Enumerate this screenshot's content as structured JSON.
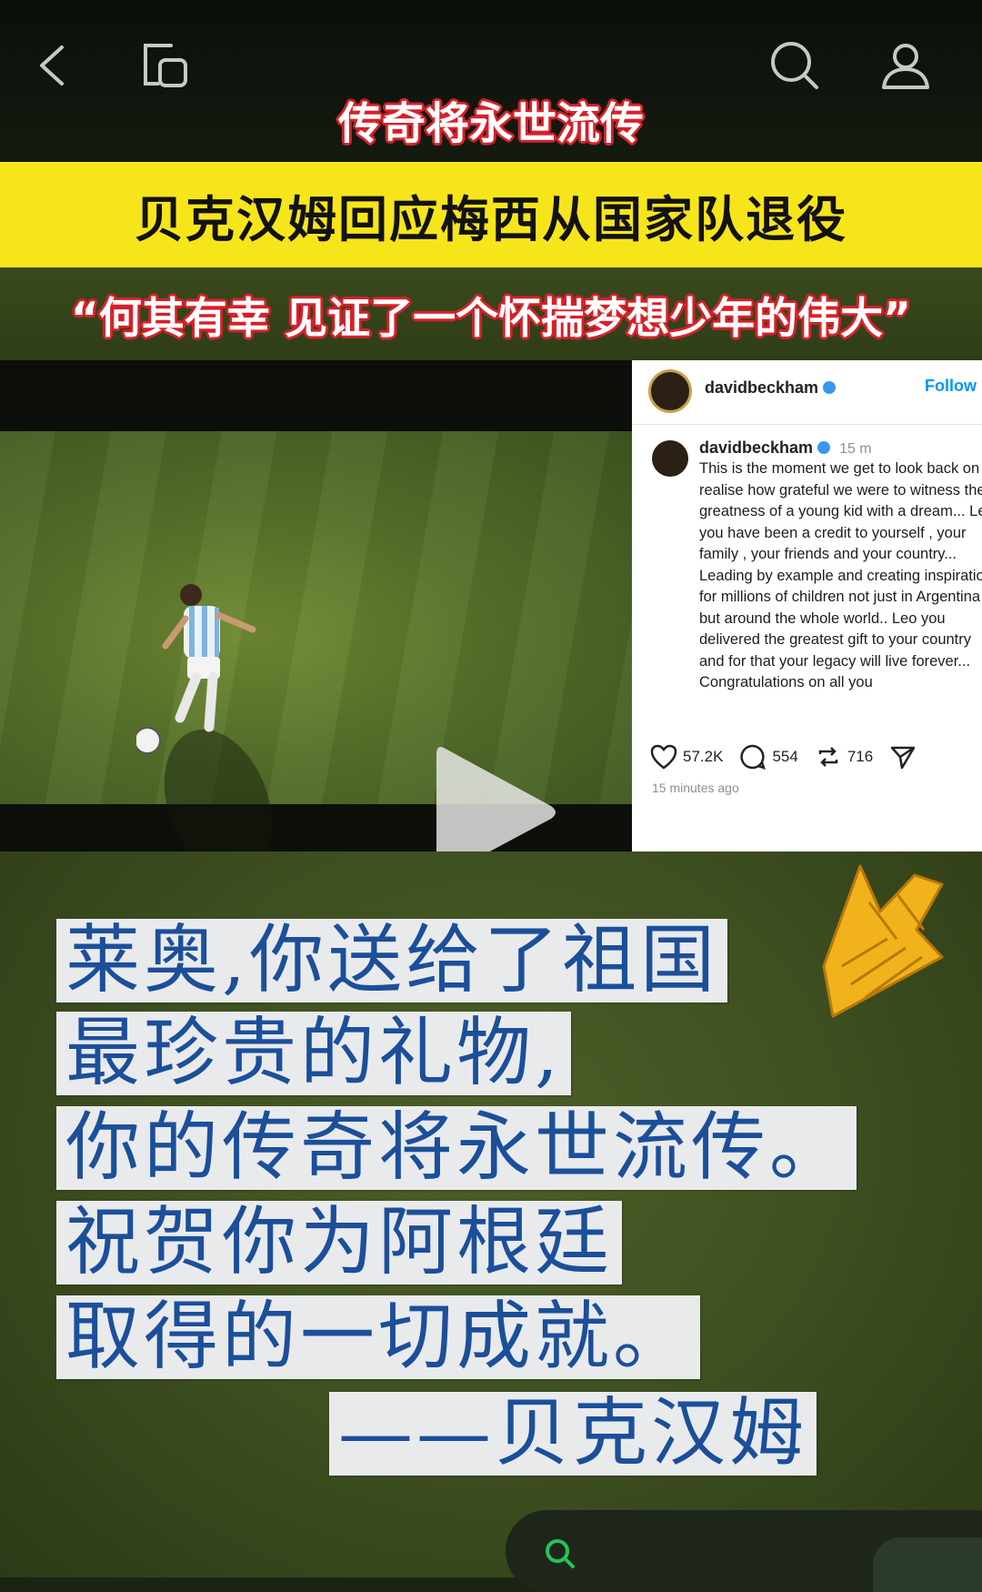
{
  "header": {
    "headline": "传奇将永世流传",
    "title": "贝克汉姆回应梅西从国家队退役",
    "quote": "“何其有幸 见证了一个怀揣梦想少年的伟大”"
  },
  "instagram": {
    "handle": "davidbeckham",
    "follow_label": "Follow",
    "post_handle": "davidbeckham",
    "post_time": "15 m",
    "caption": "This is the moment we get to look back on & realise how grateful we were to witness the greatness of a young kid with a dream... Leo you have been a credit to yourself , your family , your friends and your country... Leading by example and creating inspiration for millions of children not just in Argentina but around the whole world.. Leo you delivered the greatest gift to your country and for that your legacy will live forever... Congratulations on all you",
    "likes": "57.2K",
    "comments": "554",
    "reposts": "716",
    "posted_ago": "15 minutes ago"
  },
  "message": {
    "lines": [
      "莱奥,你送给了祖国",
      "最珍贵的礼物,",
      "你的传奇将永世流传。",
      "祝贺你为阿根廷",
      "取得的一切成就。",
      "——贝克汉姆"
    ]
  },
  "colors": {
    "headline_outline": "#d8202a",
    "title_bar": "#f7e51b",
    "message_text": "#1b4f9a",
    "arrow": "#f2b21b"
  }
}
